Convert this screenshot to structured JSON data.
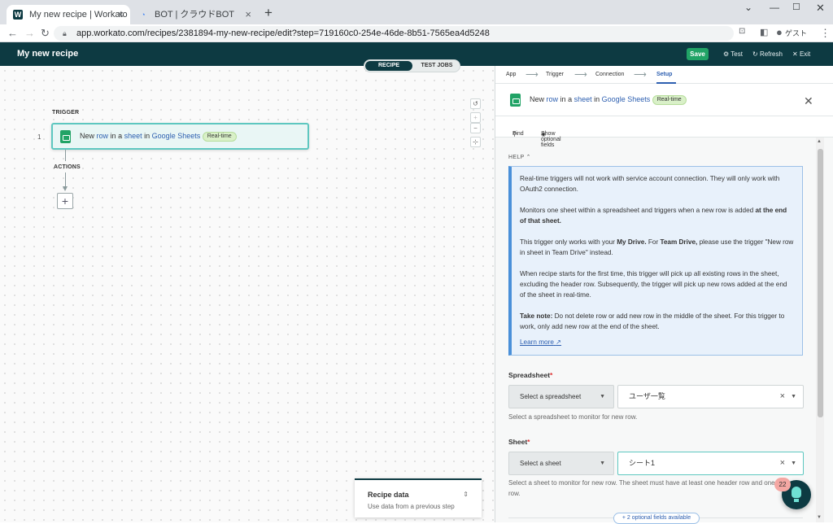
{
  "browser": {
    "tabs": [
      {
        "title": "My new recipe | Workato",
        "icon": "workato-favicon"
      },
      {
        "title": "BOT | クラウドBOT",
        "icon": "cloudbot-favicon"
      }
    ],
    "url": "app.workato.com/recipes/2381894-my-new-recipe/edit?step=719160c0-254e-46de-8b51-7565ea4d5248",
    "profile_label": "ゲスト"
  },
  "appbar": {
    "title": "My new recipe",
    "save_label": "Save",
    "test_label": "Test",
    "refresh_label": "Refresh",
    "exit_label": "Exit"
  },
  "canvas": {
    "toggle": {
      "recipe": "RECIPE",
      "test_jobs": "TEST JOBS"
    },
    "trigger_label": "TRIGGER",
    "actions_label": "ACTIONS",
    "step_number": "1",
    "step": {
      "prefix": "New",
      "row": "row",
      "in1": "in a",
      "sheet": "sheet",
      "in2": "in",
      "app": "Google Sheets",
      "badge": "Real-time"
    }
  },
  "recipe_data": {
    "title": "Recipe data",
    "subtitle": "Use data from a previous step"
  },
  "panel": {
    "crumbs": [
      "App",
      "Trigger",
      "Connection",
      "Setup"
    ],
    "header": {
      "prefix": "New",
      "row": "row",
      "in1": "in a",
      "sheet": "sheet",
      "in2": "in",
      "app": "Google Sheets",
      "badge": "Real-time"
    },
    "find_label": "Find",
    "optional_label": "Show optional fields",
    "help_label": "HELP",
    "help": {
      "p1": "Real-time triggers will not work with service account connection. They will only work with OAuth2 connection.",
      "p2a": "Monitors one sheet within a spreadsheet and triggers when a new row is added",
      "p2b": "at the end of that sheet.",
      "p3a": "This trigger only works with your",
      "p3b": "My Drive.",
      "p3c": "For",
      "p3d": "Team Drive,",
      "p3e": "please use the trigger \"New row in sheet in Team Drive\" instead.",
      "p4": "When recipe starts for the first time, this trigger will pick up all existing rows in the sheet, excluding the header row. Subsequently, the trigger will pick up new rows added at the end of the sheet in real-time.",
      "p5a": "Take note:",
      "p5b": "Do not delete row or add new row in the middle of the sheet. For this trigger to work, only add new row at the end of the sheet.",
      "learn_more": "Learn more"
    },
    "spreadsheet": {
      "label": "Spreadsheet",
      "select_label": "Select a spreadsheet",
      "value": "ユーザ一覧",
      "hint": "Select a spreadsheet to monitor for new row."
    },
    "sheet": {
      "label": "Sheet",
      "select_label": "Select a sheet",
      "value": "シート1",
      "hint": "Select a sheet to monitor for new row. The sheet must have at least one header row and one data row."
    },
    "optional_fields": "+ 2 optional fields available"
  },
  "notification_count": "22"
}
